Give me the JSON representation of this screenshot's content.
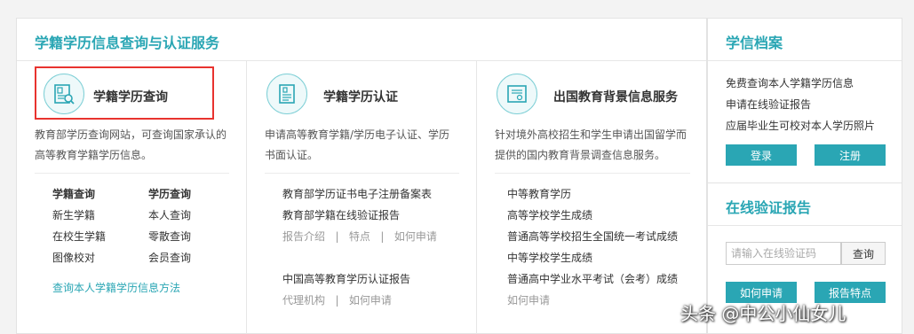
{
  "main": {
    "title": "学籍学历信息查询与认证服务",
    "col1": {
      "title": "学籍学历查询",
      "desc_line1": "教育部学历查询网站，可查询国家承认的",
      "desc_line2": "高等教育学籍学历信息。",
      "grid": {
        "h1": "学籍查询",
        "h2": "学历查询",
        "r1c1": "新生学籍",
        "r1c2": "本人查询",
        "r2c1": "在校生学籍",
        "r2c2": "零散查询",
        "r3c1": "图像校对",
        "r3c2": "会员查询"
      },
      "link": "查询本人学籍学历信息方法",
      "icon": "id-card-search-icon"
    },
    "col2": {
      "title": "学籍学历认证",
      "desc_line1": "申请高等教育学籍/学历电子认证、学历",
      "desc_line2": "书面认证。",
      "link1": "教育部学历证书电子注册备案表",
      "link2": "教育部学籍在线验证报告",
      "sub1": "报告介绍   |   特点   |   如何申请",
      "link3": "中国高等教育学历认证报告",
      "sub2": "代理机构   |   如何申请",
      "icon": "document-certificate-icon"
    },
    "col3": {
      "title": "出国教育背景信息服务",
      "desc_line1": "针对境外高校招生和学生申请出国留学而",
      "desc_line2": "提供的国内教育背景调查信息服务。",
      "items": [
        "中等教育学历",
        "高等学校学生成绩",
        "普通高等学校招生全国统一考试成绩",
        "中等学校学生成绩",
        "普通高中学业水平考试（会考）成绩",
        "如何申请"
      ],
      "icon": "certificate-stamp-icon"
    }
  },
  "side": {
    "archive_title": "学信档案",
    "archive_items": [
      "免费查询本人学籍学历信息",
      "申请在线验证报告",
      "应届毕业生可校对本人学历照片"
    ],
    "login_label": "登录",
    "register_label": "注册",
    "verify_title": "在线验证报告",
    "verify_placeholder": "请输入在线验证码",
    "query_label": "查询",
    "how_apply_label": "如何申请",
    "report_features_label": "报告特点"
  },
  "watermark": "头条 @中公小仙女儿",
  "colors": {
    "accent": "#2aa6b4",
    "highlight": "#e8332f"
  }
}
